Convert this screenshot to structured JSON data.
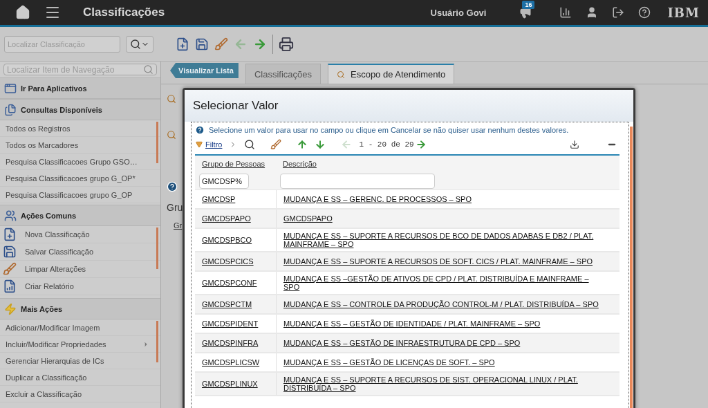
{
  "top_bar": {
    "title": "Classificações",
    "user": "Usuário Govi",
    "notification_count": "16",
    "logo": "IBM"
  },
  "toolbar": {
    "search": {
      "placeholder": "Localizar Classificação"
    },
    "buttons": [
      {
        "kind": "new",
        "disabled": false
      },
      {
        "kind": "save",
        "disabled": false
      },
      {
        "kind": "clear",
        "disabled": false
      },
      {
        "kind": "back",
        "disabled": true
      },
      {
        "kind": "forward",
        "disabled": false
      },
      {
        "kind": "print",
        "disabled": false
      }
    ]
  },
  "sidebar": {
    "search": {
      "placeholder": "Localizar Item de Navegação"
    },
    "sections": [
      {
        "kind": "apps",
        "title": "Ir Para Aplicativos"
      },
      {
        "kind": "queries",
        "title": "Consultas Disponíveis",
        "items": [
          {
            "label": "Todos os Registros"
          },
          {
            "label": "Todos os Marcadores"
          },
          {
            "label": "Pesquisa Classificacoes Grupo GSO…"
          },
          {
            "label": "Pesquisa Classificacoes grupo G_OP*"
          },
          {
            "label": "Pesquisa Classificacoes grupo G_OP"
          }
        ]
      },
      {
        "kind": "common",
        "title": "Ações Comuns",
        "items": [
          {
            "kind": "new",
            "label": "Nova Classificação"
          },
          {
            "kind": "save",
            "label": "Salvar Classificação"
          },
          {
            "kind": "clear",
            "label": "Limpar Alterações"
          },
          {
            "kind": "report",
            "label": "Criar Relatório"
          }
        ]
      },
      {
        "kind": "more",
        "title": "Mais Ações",
        "items": [
          {
            "label": "Adicionar/Modificar Imagem",
            "has_submenu": false
          },
          {
            "label": "Incluir/Modificar Propriedades",
            "has_submenu": true
          },
          {
            "label": "Gerenciar Hierarquias de ICs",
            "has_submenu": false
          },
          {
            "label": "Duplicar a Classificação",
            "has_submenu": false
          },
          {
            "label": "Excluir a Classificação",
            "has_submenu": false
          }
        ]
      }
    ]
  },
  "tabs": {
    "back_button": "Visualizar Lista",
    "items": [
      {
        "label": "Classificações",
        "selected": false
      },
      {
        "label": "Escopo de Atendimento",
        "selected": true
      }
    ]
  },
  "background_form": {
    "heading": "Gru",
    "column": "Gr"
  },
  "dialog": {
    "title": "Selecionar Valor",
    "hint": "Selecione um valor para usar no campo ou clique em Cancelar se não quiser usar nenhum destes valores.",
    "filter_label": "Filtro",
    "pagination": "1 - 20 de 29",
    "columns": [
      "Grupo de Pessoas",
      "Descrição"
    ],
    "filter_value": "GMCDSP%",
    "rows": [
      {
        "group": "GMCDSP",
        "description": "MUDANÇA E SS – GERENC. DE PROCESSOS – SPO"
      },
      {
        "group": "GMCDSPAPO",
        "description": "GMCDSPAPO"
      },
      {
        "group": "GMCDSPBCO",
        "description": "MUDANÇA E SS – SUPORTE A RECURSOS DE BCO DE DADOS ADABAS E DB2 / PLAT. MAINFRAME – SPO"
      },
      {
        "group": "GMCDSPCICS",
        "description": "MUDANÇA E SS – SUPORTE A RECURSOS DE SOFT. CICS / PLAT. MAINFRAME – SPO"
      },
      {
        "group": "GMCDSPCONF",
        "description": "MUDANÇA E SS –GESTÃO DE ATIVOS DE CPD / PLAT. DISTRIBUÍDA E MAINFRAME – SPO"
      },
      {
        "group": "GMCDSPCTM",
        "description": "MUDANÇA E SS – CONTROLE DA PRODUÇÃO CONTROL-M / PLAT. DISTRIBUÍDA – SPO"
      },
      {
        "group": "GMCDSPIDENT",
        "description": "MUDANÇA E SS – GESTÃO DE IDENTIDADE / PLAT. MAINFRAME – SPO"
      },
      {
        "group": "GMCDSPINFRA",
        "description": "MUDANÇA E SS – GESTÃO DE INFRAESTRUTURA DE CPD – SPO"
      },
      {
        "group": "GMCDSPLICSW",
        "description": "MUDANÇA E SS – GESTÃO DE LICENÇAS DE SOFT. – SPO"
      },
      {
        "group": "GMCDSPLINUX",
        "description": "MUDANÇA E SS – SUPORTE A RECURSOS DE SIST. OPERACIONAL LINUX / PLAT. DISTRIBUÍDA – SPO"
      }
    ]
  }
}
